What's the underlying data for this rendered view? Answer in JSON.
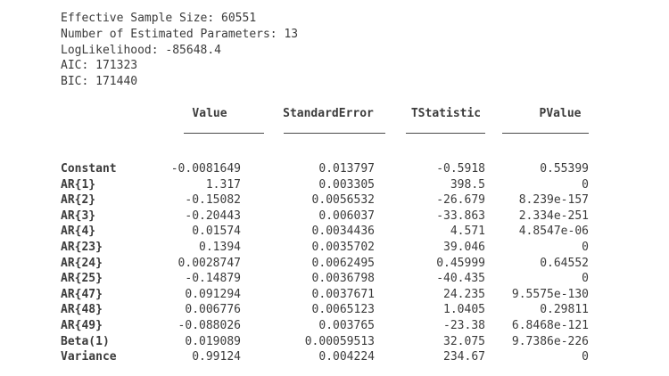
{
  "summary": {
    "effective_sample_size": "Effective Sample Size: 60551",
    "num_params": "Number of Estimated Parameters: 13",
    "loglikelihood": "LogLikelihood: -85648.4",
    "aic": "AIC: 171323",
    "bic": "BIC: 171440"
  },
  "table": {
    "headers": [
      "Value",
      "StandardError",
      "TStatistic",
      "PValue"
    ],
    "rows": [
      {
        "name": "Constant",
        "value": "-0.0081649",
        "se": "0.013797",
        "t": "-0.5918",
        "p": "0.55399"
      },
      {
        "name": "AR{1}",
        "value": "1.317",
        "se": "0.003305",
        "t": "398.5",
        "p": "0"
      },
      {
        "name": "AR{2}",
        "value": "-0.15082",
        "se": "0.0056532",
        "t": "-26.679",
        "p": "8.239e-157"
      },
      {
        "name": "AR{3}",
        "value": "-0.20443",
        "se": "0.006037",
        "t": "-33.863",
        "p": "2.334e-251"
      },
      {
        "name": "AR{4}",
        "value": "0.01574",
        "se": "0.0034436",
        "t": "4.571",
        "p": "4.8547e-06"
      },
      {
        "name": "AR{23}",
        "value": "0.1394",
        "se": "0.0035702",
        "t": "39.046",
        "p": "0"
      },
      {
        "name": "AR{24}",
        "value": "0.0028747",
        "se": "0.0062495",
        "t": "0.45999",
        "p": "0.64552"
      },
      {
        "name": "AR{25}",
        "value": "-0.14879",
        "se": "0.0036798",
        "t": "-40.435",
        "p": "0"
      },
      {
        "name": "AR{47}",
        "value": "0.091294",
        "se": "0.0037671",
        "t": "24.235",
        "p": "9.5575e-130"
      },
      {
        "name": "AR{48}",
        "value": "0.006776",
        "se": "0.0065123",
        "t": "1.0405",
        "p": "0.29811"
      },
      {
        "name": "AR{49}",
        "value": "-0.088026",
        "se": "0.003765",
        "t": "-23.38",
        "p": "6.8468e-121"
      },
      {
        "name": "Beta(1)",
        "value": "0.019089",
        "se": "0.00059513",
        "t": "32.075",
        "p": "9.7386e-226"
      },
      {
        "name": "Variance",
        "value": "0.99124",
        "se": "0.004224",
        "t": "234.67",
        "p": "0"
      }
    ]
  }
}
